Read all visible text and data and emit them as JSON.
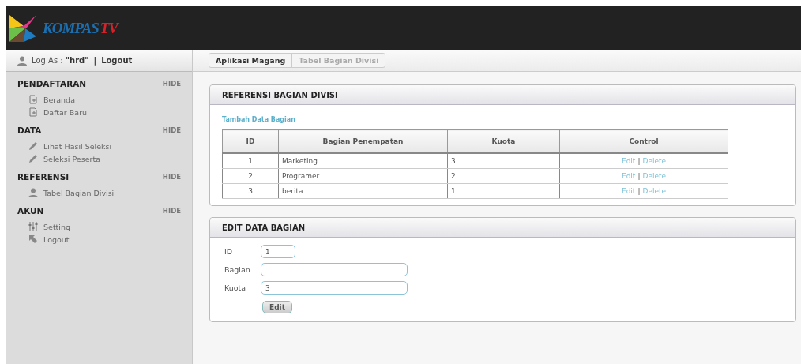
{
  "logo": {
    "word": "KOMPAS",
    "suffix": "TV"
  },
  "userbar": {
    "label": "Log As : ",
    "user": "\"hrd\"",
    "separator": "|",
    "logout": "Logout"
  },
  "sidebar": {
    "sections": [
      {
        "title": "PENDAFTARAN",
        "toggle": "HIDE",
        "items": [
          {
            "label": "Beranda",
            "kind": "doc"
          },
          {
            "label": "Daftar Baru",
            "kind": "doc"
          }
        ]
      },
      {
        "title": "DATA",
        "toggle": "HIDE",
        "items": [
          {
            "label": "Lihat Hasil Seleksi",
            "kind": "pencil"
          },
          {
            "label": "Seleksi Peserta",
            "kind": "pencil"
          }
        ]
      },
      {
        "title": "REFERENSI",
        "toggle": "HIDE",
        "items": [
          {
            "label": "Tabel Bagian Divisi",
            "kind": "user"
          }
        ]
      },
      {
        "title": "AKUN",
        "toggle": "HIDE",
        "items": [
          {
            "label": "Setting",
            "kind": "sliders"
          },
          {
            "label": "Logout",
            "kind": "arrow"
          }
        ]
      }
    ]
  },
  "breadcrumb": [
    {
      "label": "Aplikasi Magang",
      "selected": false
    },
    {
      "label": "Tabel Bagian Divisi",
      "selected": true
    }
  ],
  "reference_panel": {
    "title": "REFERENSI BAGIAN DIVISI",
    "add_link": "Tambah Data Bagian",
    "table": {
      "columns": [
        "ID",
        "Bagian Penempatan",
        "Kuota",
        "Control"
      ],
      "rows": [
        {
          "id": "1",
          "bagian": "Marketing",
          "kuota": "3",
          "edit": "Edit",
          "separator": "|",
          "delete": "Delete"
        },
        {
          "id": "2",
          "bagian": "Programer",
          "kuota": "2",
          "edit": "Edit",
          "separator": "|",
          "delete": "Delete"
        },
        {
          "id": "3",
          "bagian": "berita",
          "kuota": "1",
          "edit": "Edit",
          "separator": "|",
          "delete": "Delete"
        }
      ]
    }
  },
  "edit_panel": {
    "title": "EDIT DATA BAGIAN",
    "fields": [
      {
        "label": "ID",
        "value": "1",
        "kind": "short"
      },
      {
        "label": "Bagian",
        "kind": "long"
      },
      {
        "label": "Kuota",
        "value": "3",
        "kind": "long"
      }
    ],
    "button": "Edit"
  }
}
